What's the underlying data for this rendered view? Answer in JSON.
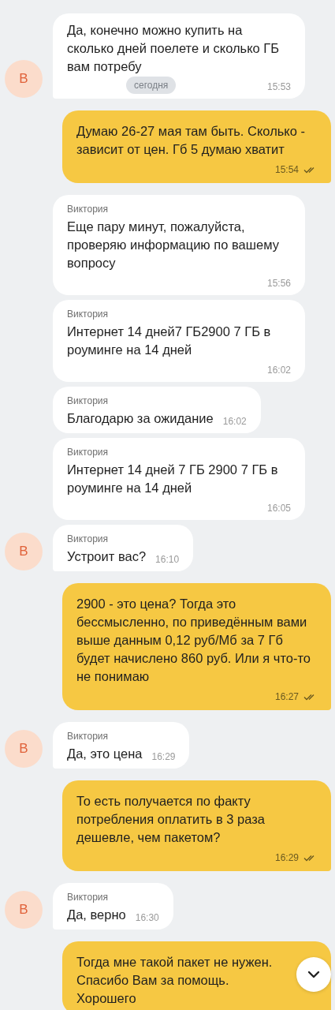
{
  "date_badge": "сегодня",
  "messages": [
    {
      "kind": "in",
      "avatar": "В",
      "text": "Да, конечно можно купить на сколько дней поелете и сколько ГБ вам потребу",
      "time": "15:53"
    },
    {
      "kind": "out",
      "text": "Думаю 26-27 мая там быть. Сколько - зависит от цен. Гб 5 думаю хватит",
      "time": "15:54",
      "read": true
    },
    {
      "kind": "in",
      "sender": "Виктория",
      "text": "Еще пару минут, пожалуйста, проверяю информацию по вашему вопросу",
      "time": "15:56"
    },
    {
      "kind": "in",
      "sender": "Виктория",
      "text": "Интернет 14 дней7 ГБ2900 7 ГБ в роуминге на 14 дней",
      "time": "16:02"
    },
    {
      "kind": "in",
      "sender": "Виктория",
      "text": "Благодарю за ожидание",
      "time": "16:02"
    },
    {
      "kind": "in",
      "sender": "Виктория",
      "text": "Интернет 14 дней 7 ГБ 2900 7 ГБ в роуминге на 14 дней",
      "time": "16:05"
    },
    {
      "kind": "in",
      "avatar": "В",
      "sender": "Виктория",
      "text": "Устроит вас?",
      "time": "16:10"
    },
    {
      "kind": "out",
      "text": "2900 - это цена? Тогда это бессмысленно, по приведённым вами выше данным 0,12 руб/Мб за 7 Гб будет начислено 860 руб. Или я что-то не понимаю",
      "time": "16:27",
      "read": true
    },
    {
      "kind": "in",
      "avatar": "В",
      "sender": "Виктория",
      "text": "Да, это цена",
      "time": "16:29"
    },
    {
      "kind": "out",
      "text": "То есть получается по факту потребления оплатить в 3 раза дешевле, чем пакетом?",
      "time": "16:29",
      "read": true
    },
    {
      "kind": "in",
      "avatar": "В",
      "sender": "Виктория",
      "text": "Да, верно",
      "time": "16:30"
    },
    {
      "kind": "out",
      "text": "Тогда мне такой пакет не нужен. Спасибо Вам за помощь. Хорошего"
    }
  ]
}
